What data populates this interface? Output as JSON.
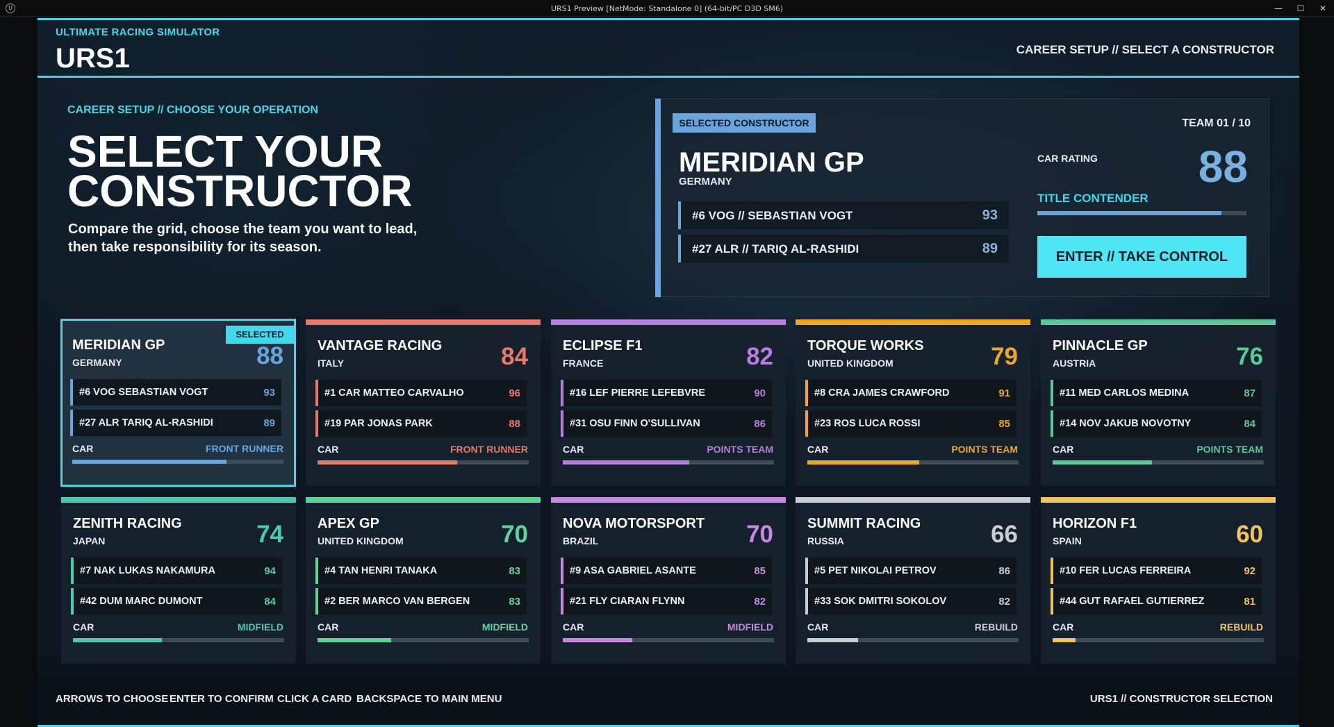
{
  "window": {
    "title": "URS1 Preview [NetMode: Standalone 0]  (64-bit/PC D3D SM6)",
    "minimize": "—",
    "maximize": "☐",
    "close": "✕"
  },
  "header": {
    "subtitle": "ULTIMATE RACING SIMULATOR",
    "title": "URS1",
    "breadcrumb": "CAREER SETUP  //  SELECT A CONSTRUCTOR"
  },
  "hero": {
    "breadcrumb": "CAREER SETUP  //  CHOOSE YOUR OPERATION",
    "title_line1": "SELECT YOUR",
    "title_line2": "CONSTRUCTOR",
    "subtitle_line1": "Compare the grid, choose the team you want to lead,",
    "subtitle_line2": "then take responsibility for its season."
  },
  "selected": {
    "tag": "SELECTED CONSTRUCTOR",
    "team_index": "TEAM 01 / 10",
    "name": "MERIDIAN GP",
    "country": "GERMANY",
    "drivers": [
      {
        "label": "#6  VOG  //  SEBASTIAN VOGT",
        "rating": "93"
      },
      {
        "label": "#27  ALR  //  TARIQ AL-RASHIDI",
        "rating": "89"
      }
    ],
    "car_rating_label": "CAR RATING",
    "car_rating": "88",
    "tier": "TITLE CONTENDER",
    "car_level": 0.88,
    "cta": "ENTER  //  TAKE CONTROL",
    "accent": "#6aa4dc"
  },
  "teams": [
    {
      "name": "MERIDIAN GP",
      "country": "GERMANY",
      "rating": "88",
      "tier": "FRONT RUNNER",
      "color": "#6aa4dc",
      "level": 0.73,
      "selected": true,
      "badge": "SELECTED",
      "drivers": [
        {
          "label": "#6 VOG  SEBASTIAN VOGT",
          "rating": "93"
        },
        {
          "label": "#27 ALR  TARIQ AL-RASHIDI",
          "rating": "89"
        }
      ]
    },
    {
      "name": "VANTAGE RACING",
      "country": "ITALY",
      "rating": "84",
      "tier": "FRONT RUNNER",
      "color": "#e8796a",
      "level": 0.66,
      "drivers": [
        {
          "label": "#1 CAR  MATTEO CARVALHO",
          "rating": "96"
        },
        {
          "label": "#19 PAR  JONAS PARK",
          "rating": "88"
        }
      ]
    },
    {
      "name": "ECLIPSE F1",
      "country": "FRANCE",
      "rating": "82",
      "tier": "POINTS TEAM",
      "color": "#b57fe0",
      "level": 0.6,
      "drivers": [
        {
          "label": "#16 LEF  PIERRE LEFEBVRE",
          "rating": "90"
        },
        {
          "label": "#31 OSU  FINN O'SULLIVAN",
          "rating": "86"
        }
      ]
    },
    {
      "name": "TORQUE WORKS",
      "country": "UNITED KINGDOM",
      "rating": "79",
      "tier": "POINTS TEAM",
      "color": "#f0a61e",
      "level": 0.53,
      "drivers": [
        {
          "label": "#8 CRA  JAMES CRAWFORD",
          "rating": "91"
        },
        {
          "label": "#23 ROS  LUCA ROSSI",
          "rating": "85"
        }
      ]
    },
    {
      "name": "PINNACLE GP",
      "country": "AUSTRIA",
      "rating": "76",
      "tier": "POINTS TEAM",
      "color": "#5cc79a",
      "level": 0.47,
      "drivers": [
        {
          "label": "#11 MED  CARLOS MEDINA",
          "rating": "87"
        },
        {
          "label": "#14 NOV  JAKUB NOVOTNY",
          "rating": "84"
        }
      ]
    },
    {
      "name": "ZENITH RACING",
      "country": "JAPAN",
      "rating": "74",
      "tier": "MIDFIELD",
      "color": "#4cc8b4",
      "level": 0.42,
      "drivers": [
        {
          "label": "#7 NAK  LUKAS NAKAMURA",
          "rating": "94"
        },
        {
          "label": "#42 DUM  MARC DUMONT",
          "rating": "84"
        }
      ]
    },
    {
      "name": "APEX GP",
      "country": "UNITED KINGDOM",
      "rating": "70",
      "tier": "MIDFIELD",
      "color": "#5fd49a",
      "level": 0.35,
      "drivers": [
        {
          "label": "#4 TAN  HENRI TANAKA",
          "rating": "83"
        },
        {
          "label": "#2 BER  MARCO VAN BERGEN",
          "rating": "83"
        }
      ]
    },
    {
      "name": "NOVA MOTORSPORT",
      "country": "BRAZIL",
      "rating": "70",
      "tier": "MIDFIELD",
      "color": "#c78ae0",
      "level": 0.33,
      "drivers": [
        {
          "label": "#9 ASA  GABRIEL ASANTE",
          "rating": "85"
        },
        {
          "label": "#21 FLY  CIARAN FLYNN",
          "rating": "82"
        }
      ]
    },
    {
      "name": "SUMMIT RACING",
      "country": "RUSSIA",
      "rating": "66",
      "tier": "REBUILD",
      "color": "#c8cdd2",
      "level": 0.24,
      "drivers": [
        {
          "label": "#5 PET  NIKOLAI PETROV",
          "rating": "86"
        },
        {
          "label": "#33 SOK  DMITRI SOKOLOV",
          "rating": "82"
        }
      ]
    },
    {
      "name": "HORIZON F1",
      "country": "SPAIN",
      "rating": "60",
      "tier": "REBUILD",
      "color": "#f2c35a",
      "level": 0.11,
      "drivers": [
        {
          "label": "#10 FER  LUCAS FERREIRA",
          "rating": "92"
        },
        {
          "label": "#44 GUT  RAFAEL GUTIERREZ",
          "rating": "81"
        }
      ]
    }
  ],
  "card_car_label": "CAR",
  "footer": {
    "hints": [
      "ARROWS TO CHOOSE",
      "ENTER TO CONFIRM",
      "CLICK A CARD",
      "BACKSPACE TO MAIN MENU"
    ],
    "right": "URS1  //  CONSTRUCTOR SELECTION"
  }
}
